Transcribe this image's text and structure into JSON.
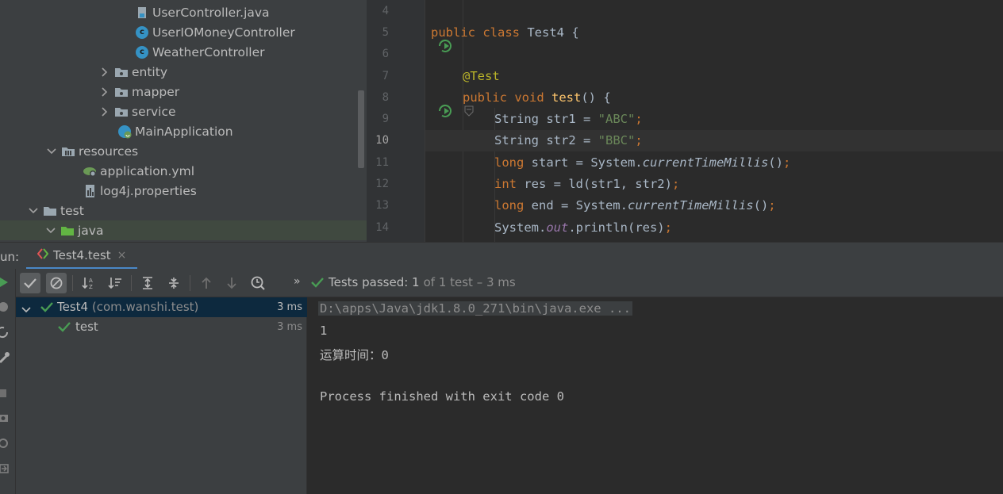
{
  "project_tree": {
    "items": [
      {
        "label": "UserController.java",
        "kind": "java-file",
        "depth": 4
      },
      {
        "label": "UserIOMoneyController",
        "kind": "class",
        "depth": 4
      },
      {
        "label": "WeatherController",
        "kind": "class",
        "depth": 4
      },
      {
        "label": "entity",
        "kind": "package",
        "depth": 3,
        "expanded": false
      },
      {
        "label": "mapper",
        "kind": "package",
        "depth": 3,
        "expanded": false
      },
      {
        "label": "service",
        "kind": "package",
        "depth": 3,
        "expanded": false
      },
      {
        "label": "MainApplication",
        "kind": "spring-class",
        "depth": 3
      },
      {
        "label": "resources",
        "kind": "resources-folder",
        "depth": 1,
        "expanded": true
      },
      {
        "label": "application.yml",
        "kind": "yml-file",
        "depth": 2
      },
      {
        "label": "log4j.properties",
        "kind": "properties-file",
        "depth": 2
      },
      {
        "label": "test",
        "kind": "folder",
        "depth": 0,
        "expanded": true
      },
      {
        "label": "java",
        "kind": "test-sources-folder",
        "depth": 1,
        "expanded": true,
        "selected": true
      }
    ]
  },
  "editor": {
    "current_line": "10",
    "lines": [
      {
        "num": "4"
      },
      {
        "num": "5",
        "run_icon": true
      },
      {
        "num": "6"
      },
      {
        "num": "7"
      },
      {
        "num": "8",
        "run_icon": true,
        "fold_icon": true
      },
      {
        "num": "9"
      },
      {
        "num": "10"
      },
      {
        "num": "11"
      },
      {
        "num": "12"
      },
      {
        "num": "13"
      },
      {
        "num": "14"
      }
    ],
    "code": {
      "l5_kw1": "public",
      "l5_kw2": "class",
      "l5_rest": " Test4 {",
      "l7_ann": "@Test",
      "l8_kw1": "public",
      "l8_kw2": "void",
      "l8_fn": "test",
      "l8_rest": "() {",
      "l9_a": "String str1 = ",
      "l9_str": "\"ABC\"",
      "l9_semi": ";",
      "l10_a": "String str2 = ",
      "l10_str": "\"BBC\"",
      "l10_semi": ";",
      "l11_kw": "long",
      "l11_a": " start = System.",
      "l11_static": "currentTimeMillis",
      "l11_b": "()",
      "l11_semi": ";",
      "l12_kw": "int",
      "l12_a": " res = ld(str1, str2)",
      "l12_semi": ";",
      "l13_kw": "long",
      "l13_a": " end = System.",
      "l13_static": "currentTimeMillis",
      "l13_b": "()",
      "l13_semi": ";",
      "l14_a": "System.",
      "l14_field": "out",
      "l14_b": ".println(res)",
      "l14_semi": ";"
    }
  },
  "run_window": {
    "label": "un:",
    "tab_label": "Test4.test",
    "tab_close": "×",
    "more": "»",
    "status_passed_prefix": "Tests passed: ",
    "status_passed_count": "1",
    "status_rest": "of 1 test – 3 ms"
  },
  "test_tree": {
    "root": {
      "name": "Test4",
      "package": "(com.wanshi.test)",
      "time": "3 ms"
    },
    "child": {
      "name": "test",
      "time": "3 ms"
    }
  },
  "console": {
    "lines": [
      "D:\\apps\\Java\\jdk1.8.0_271\\bin\\java.exe ...",
      "1",
      "运算时间：0",
      "",
      "Process finished with exit code 0"
    ]
  },
  "colors": {
    "keyword": "#cc7832",
    "annotation": "#bbb529",
    "string": "#6a8759",
    "function": "#ffc66d",
    "field": "#9876aa",
    "pass_green": "#499c54",
    "accent": "#4a88c7"
  }
}
